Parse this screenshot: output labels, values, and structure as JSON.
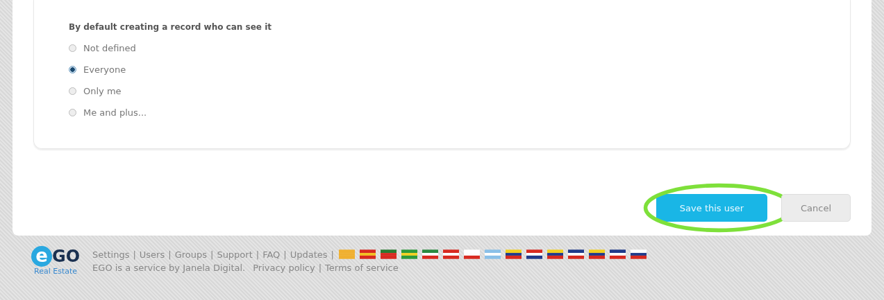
{
  "visibility": {
    "heading": "By default creating a record who can see it",
    "options": [
      {
        "label": "Not defined",
        "selected": false
      },
      {
        "label": "Everyone",
        "selected": true
      },
      {
        "label": "Only me",
        "selected": false
      },
      {
        "label": "Me and plus...",
        "selected": false
      }
    ]
  },
  "actions": [
    {
      "label": "Save this user",
      "kind": "primary",
      "highlighted": true
    },
    {
      "label": "Cancel",
      "kind": "secondary",
      "highlighted": false
    }
  ],
  "footer": {
    "logo": {
      "mark": "e",
      "name": "GO",
      "tagline": "Real Estate"
    },
    "separator": "|",
    "links": [
      "Settings",
      "Users",
      "Groups",
      "Support",
      "FAQ",
      "Updates"
    ],
    "credit": "EGO is a service by Janela Digital.",
    "legal_links": [
      "Privacy policy",
      "Terms of service"
    ]
  }
}
